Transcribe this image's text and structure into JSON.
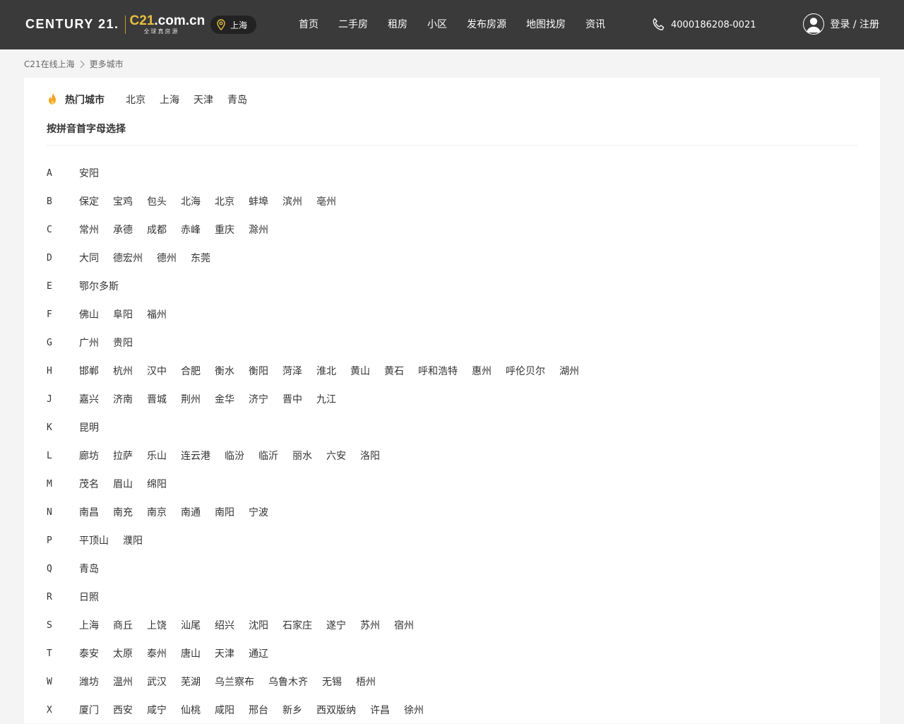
{
  "header": {
    "logo_text": "CENTURY 21.",
    "logo_c21_prefix": "C21",
    "logo_c21_suffix": ".com.cn",
    "logo_tagline": "全球真房源",
    "current_city": "上海",
    "nav": [
      "首页",
      "二手房",
      "租房",
      "小区",
      "发布房源",
      "地图找房",
      "资讯"
    ],
    "phone": "4000186208-0021",
    "login_label": "登录 / 注册"
  },
  "breadcrumb": {
    "home": "C21在线上海",
    "current": "更多城市"
  },
  "hot": {
    "title": "热门城市",
    "cities": [
      "北京",
      "上海",
      "天津",
      "青岛"
    ]
  },
  "pinyin_title": "按拼音首字母选择",
  "groups": [
    {
      "letter": "A",
      "cities": [
        "安阳"
      ]
    },
    {
      "letter": "B",
      "cities": [
        "保定",
        "宝鸡",
        "包头",
        "北海",
        "北京",
        "蚌埠",
        "滨州",
        "亳州"
      ]
    },
    {
      "letter": "C",
      "cities": [
        "常州",
        "承德",
        "成都",
        "赤峰",
        "重庆",
        "滁州"
      ]
    },
    {
      "letter": "D",
      "cities": [
        "大同",
        "德宏州",
        "德州",
        "东莞"
      ]
    },
    {
      "letter": "E",
      "cities": [
        "鄂尔多斯"
      ]
    },
    {
      "letter": "F",
      "cities": [
        "佛山",
        "阜阳",
        "福州"
      ]
    },
    {
      "letter": "G",
      "cities": [
        "广州",
        "贵阳"
      ]
    },
    {
      "letter": "H",
      "cities": [
        "邯郸",
        "杭州",
        "汉中",
        "合肥",
        "衡水",
        "衡阳",
        "菏泽",
        "淮北",
        "黄山",
        "黄石",
        "呼和浩特",
        "惠州",
        "呼伦贝尔",
        "湖州"
      ]
    },
    {
      "letter": "J",
      "cities": [
        "嘉兴",
        "济南",
        "晋城",
        "荆州",
        "金华",
        "济宁",
        "晋中",
        "九江"
      ]
    },
    {
      "letter": "K",
      "cities": [
        "昆明"
      ]
    },
    {
      "letter": "L",
      "cities": [
        "廊坊",
        "拉萨",
        "乐山",
        "连云港",
        "临汾",
        "临沂",
        "丽水",
        "六安",
        "洛阳"
      ]
    },
    {
      "letter": "M",
      "cities": [
        "茂名",
        "眉山",
        "绵阳"
      ]
    },
    {
      "letter": "N",
      "cities": [
        "南昌",
        "南充",
        "南京",
        "南通",
        "南阳",
        "宁波"
      ]
    },
    {
      "letter": "P",
      "cities": [
        "平顶山",
        "濮阳"
      ]
    },
    {
      "letter": "Q",
      "cities": [
        "青岛"
      ]
    },
    {
      "letter": "R",
      "cities": [
        "日照"
      ]
    },
    {
      "letter": "S",
      "cities": [
        "上海",
        "商丘",
        "上饶",
        "汕尾",
        "绍兴",
        "沈阳",
        "石家庄",
        "遂宁",
        "苏州",
        "宿州"
      ]
    },
    {
      "letter": "T",
      "cities": [
        "泰安",
        "太原",
        "泰州",
        "唐山",
        "天津",
        "通辽"
      ]
    },
    {
      "letter": "W",
      "cities": [
        "潍坊",
        "温州",
        "武汉",
        "芜湖",
        "乌兰察布",
        "乌鲁木齐",
        "无锡",
        "梧州"
      ]
    },
    {
      "letter": "X",
      "cities": [
        "厦门",
        "西安",
        "咸宁",
        "仙桃",
        "咸阳",
        "邢台",
        "新乡",
        "西双版纳",
        "许昌",
        "徐州"
      ]
    }
  ],
  "colors": {
    "header_bg": "#3a3a3a",
    "accent_gold": "#e8c040",
    "fire_orange": "#f5a623"
  }
}
